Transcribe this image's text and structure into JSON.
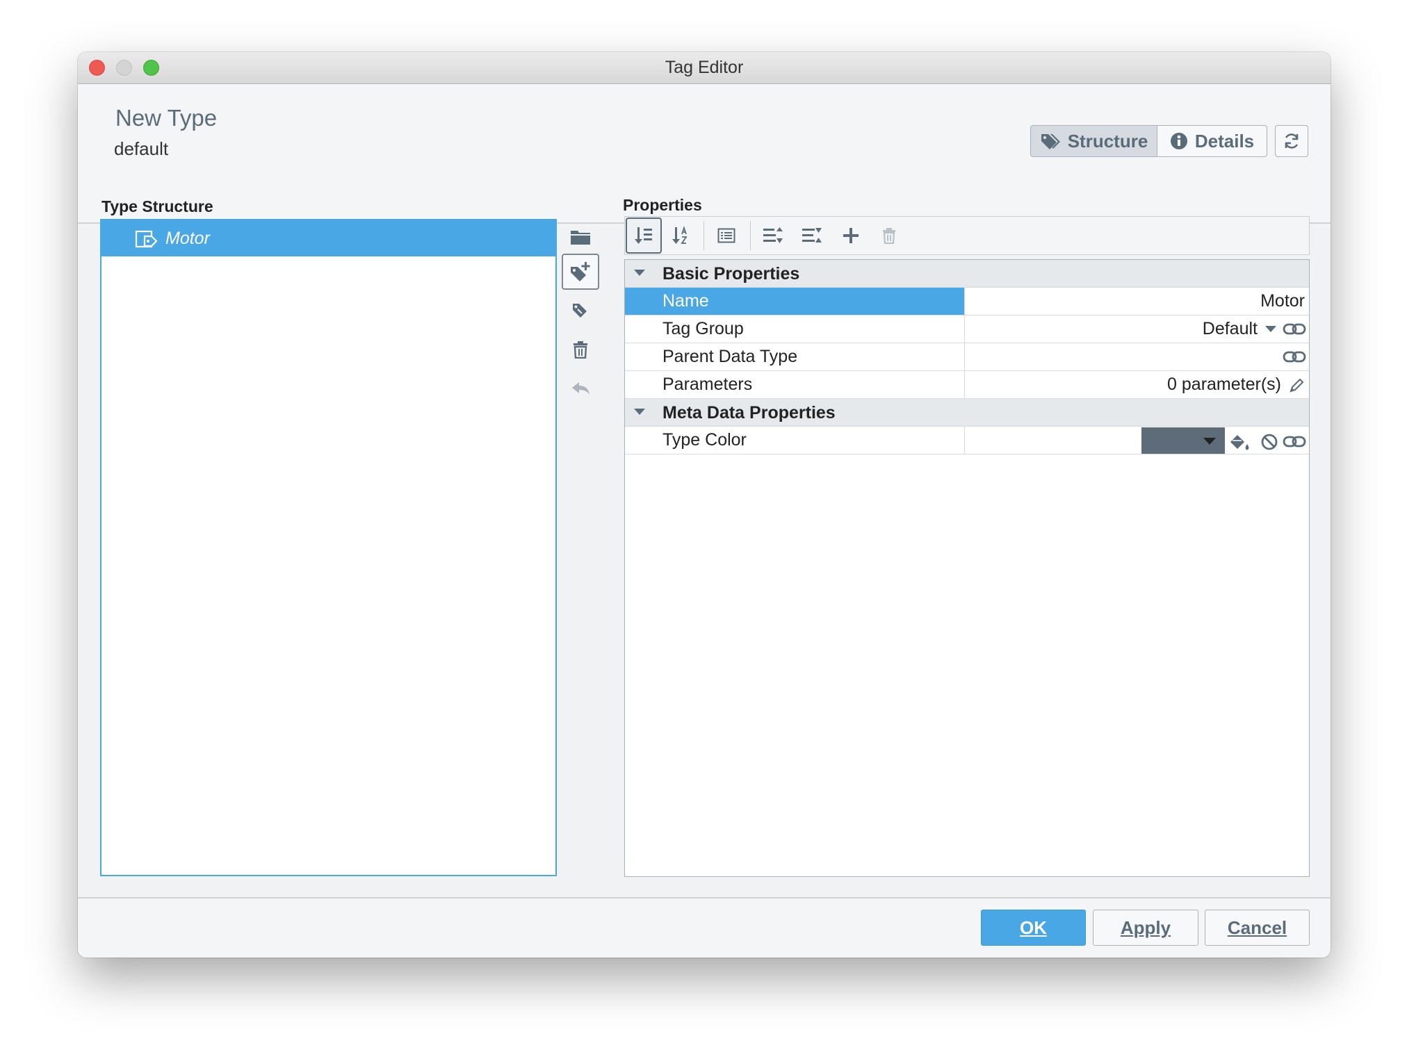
{
  "window": {
    "title": "Tag Editor"
  },
  "header": {
    "type_name": "New Type",
    "provider": "default",
    "tabs": {
      "structure": "Structure",
      "details": "Details"
    }
  },
  "type_structure": {
    "label": "Type Structure",
    "items": [
      {
        "label": "Motor",
        "selected": true
      }
    ]
  },
  "properties": {
    "label": "Properties",
    "groups": [
      {
        "title": "Basic Properties",
        "rows": [
          {
            "name": "Name",
            "value": "Motor"
          },
          {
            "name": "Tag Group",
            "value": "Default"
          },
          {
            "name": "Parent Data Type",
            "value": ""
          },
          {
            "name": "Parameters",
            "value": "0 parameter(s)"
          }
        ]
      },
      {
        "title": "Meta Data Properties",
        "rows": [
          {
            "name": "Type Color",
            "value": ""
          }
        ]
      }
    ]
  },
  "footer": {
    "ok": "OK",
    "apply": "Apply",
    "cancel": "Cancel"
  },
  "colors": {
    "accent": "#4aa7e6",
    "type_color": "#5e6b78",
    "icon": "#5a6b7a"
  }
}
